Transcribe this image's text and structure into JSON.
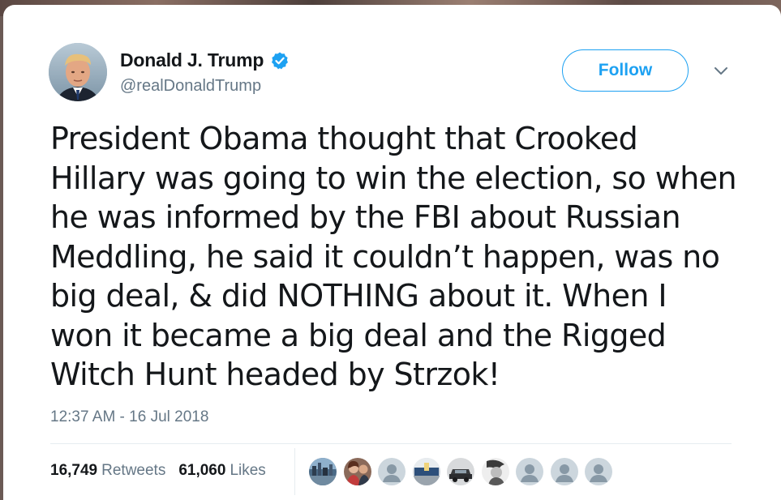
{
  "author": {
    "display_name": "Donald J. Trump",
    "handle": "@realDonaldTrump",
    "verified": true,
    "avatar_icon": "profile-photo"
  },
  "follow_button": {
    "label": "Follow"
  },
  "menu": {
    "icon": "chevron-down-icon"
  },
  "tweet": {
    "text": "President Obama thought that Crooked\nHillary was going to win the election, so when\nhe was informed by the FBI about Russian\nMeddling, he said it couldn’t happen, was no\nbig deal, & did NOTHING about it. When I\nwon it became a big deal and the Rigged\nWitch Hunt headed by Strzok!",
    "timestamp": "12:37 AM - 16 Jul 2018"
  },
  "stats": {
    "retweets_count": "16,749",
    "retweets_label": "Retweets",
    "likes_count": "61,060",
    "likes_label": "Likes"
  },
  "likers": [
    {
      "kind": "photo-city"
    },
    {
      "kind": "photo-couple"
    },
    {
      "kind": "default-avatar"
    },
    {
      "kind": "photo-room"
    },
    {
      "kind": "photo-car"
    },
    {
      "kind": "photo-bw-portrait"
    },
    {
      "kind": "default-avatar"
    },
    {
      "kind": "default-avatar"
    },
    {
      "kind": "default-avatar"
    }
  ],
  "colors": {
    "accent": "#1da1f2",
    "text_primary": "#14171a",
    "text_secondary": "#657786",
    "divider": "#e6ecf0"
  }
}
